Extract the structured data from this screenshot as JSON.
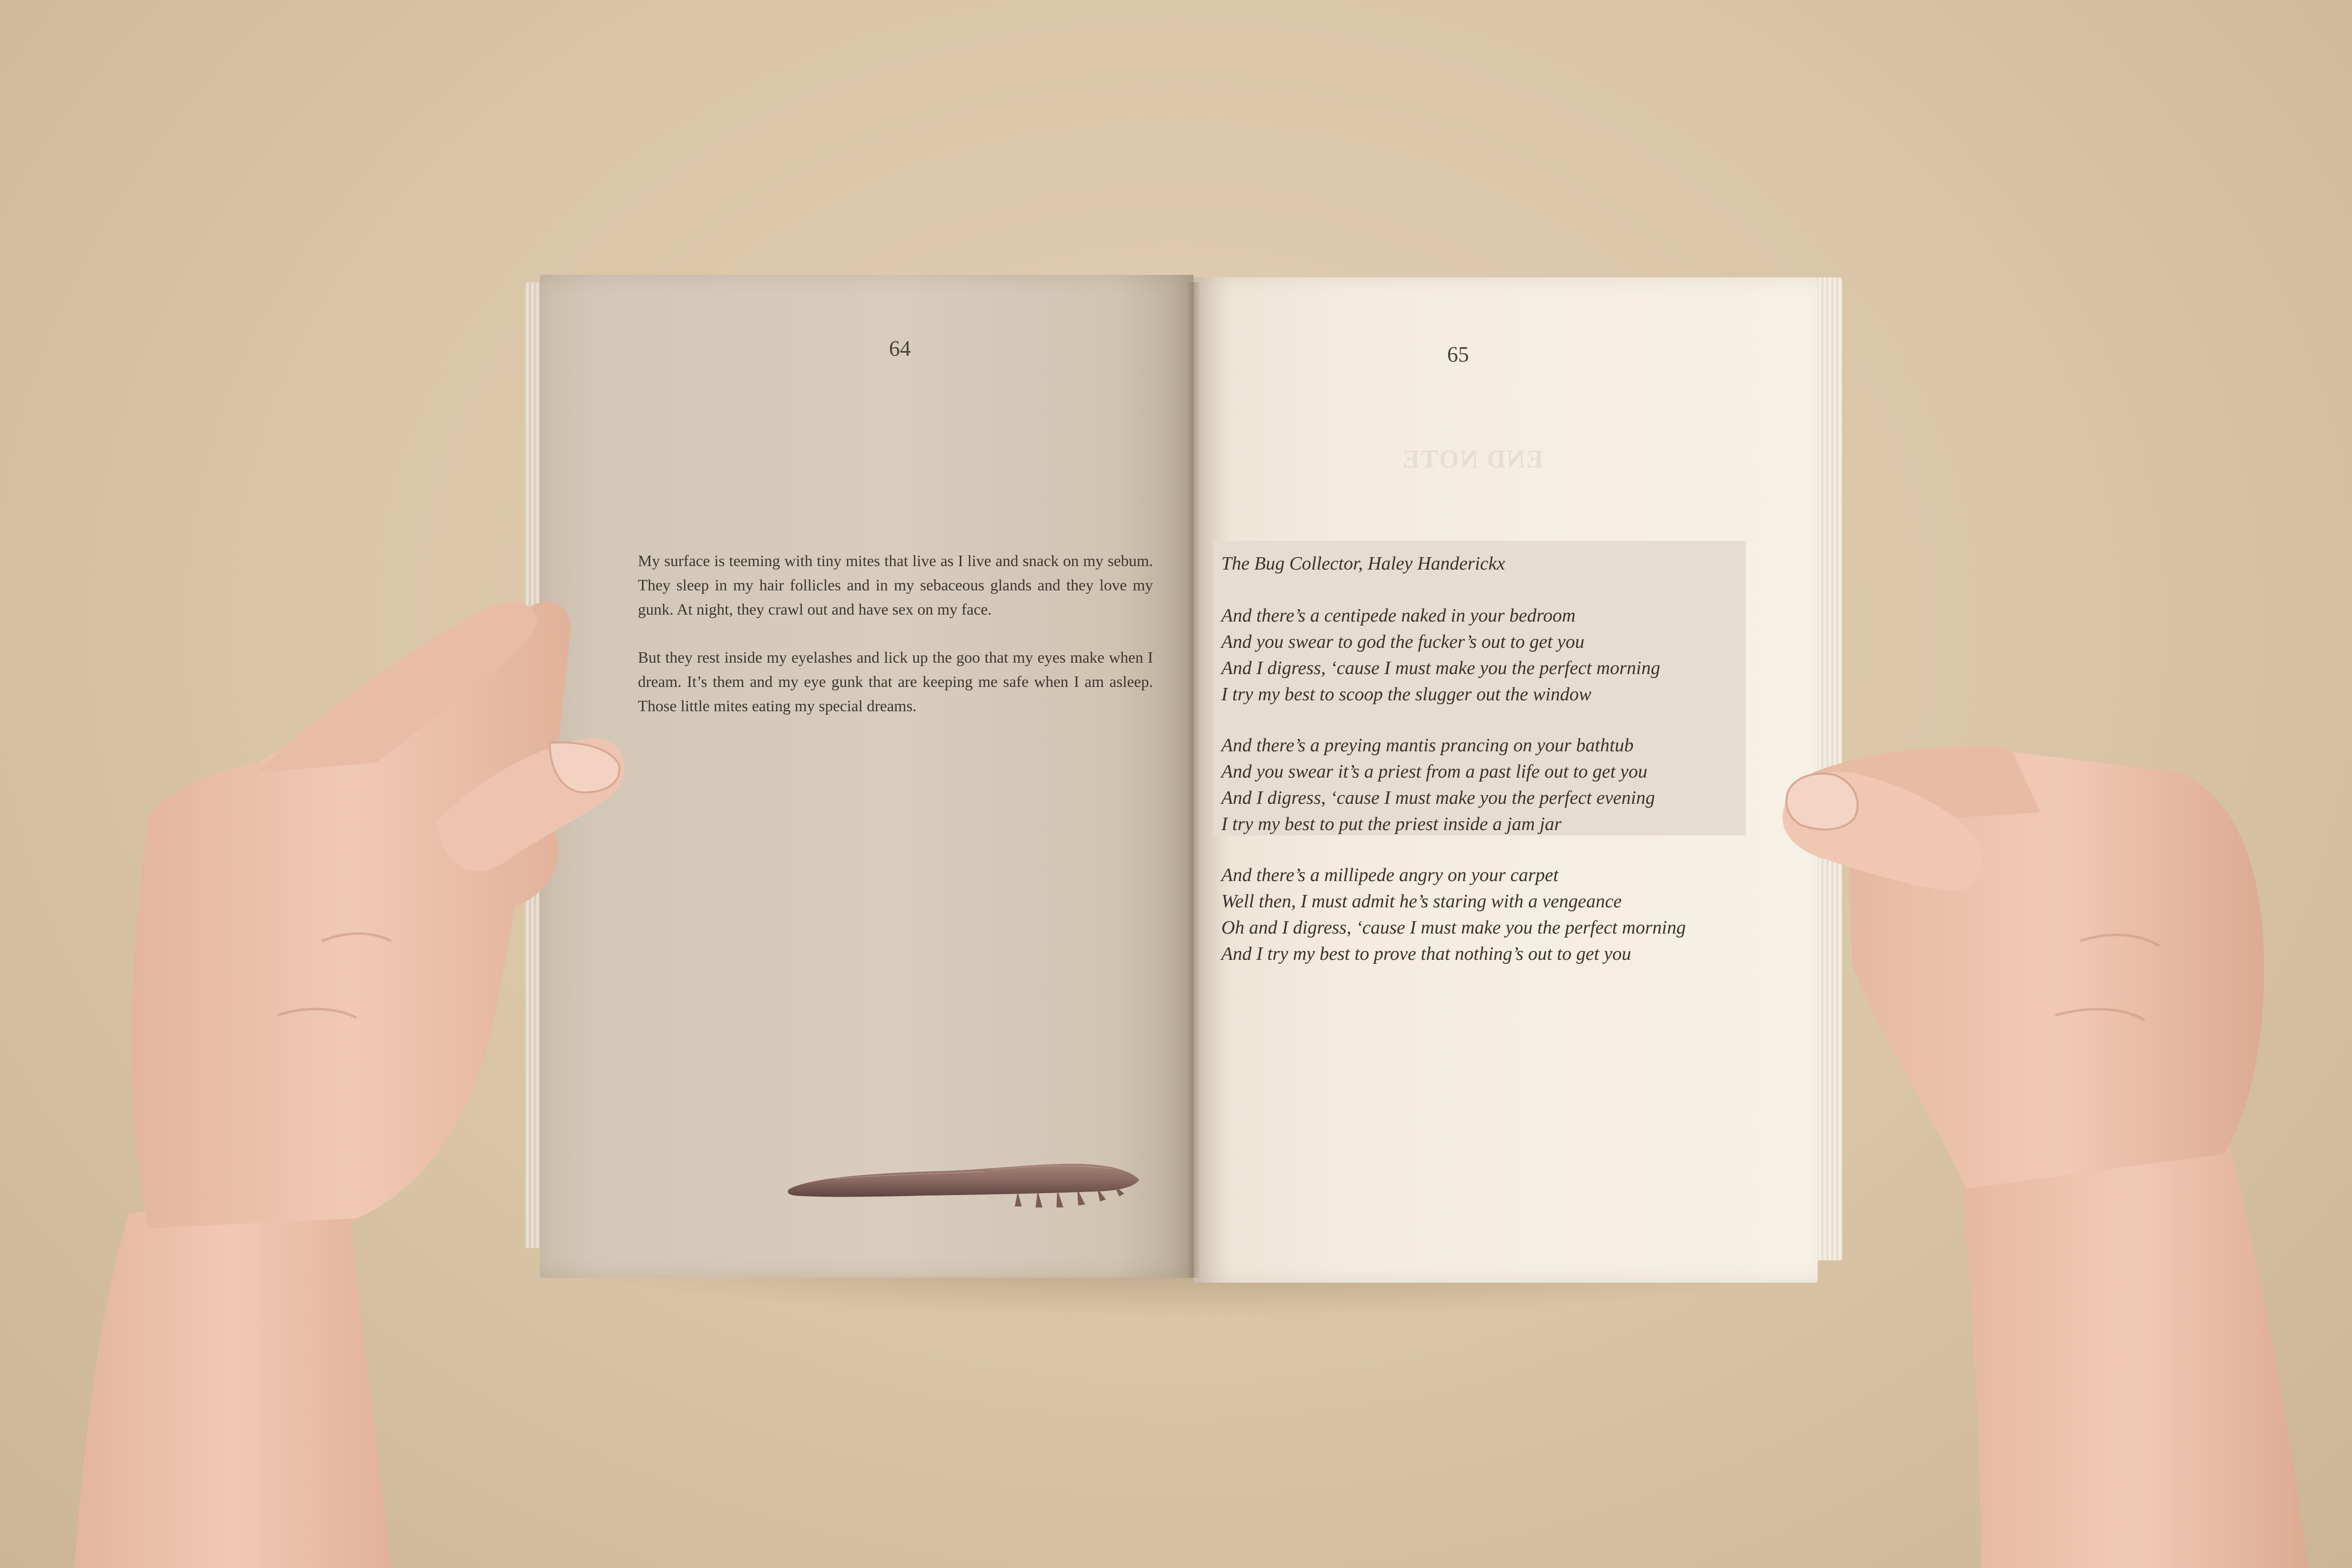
{
  "book": {
    "left_page": {
      "page_number": "64",
      "paragraphs": [
        "My surface is teeming with tiny mites that live as I live and snack on my sebum. They sleep in my hair follicles and in my sebaceous glands and they love my gunk. At night, they crawl out and have sex on my face.",
        "But they rest inside my eyelashes and lick up the goo that my eyes make when I dream. It’s them and my eye gunk that are keeping me safe when I am asleep. Those little mites eating my special dreams."
      ]
    },
    "right_page": {
      "page_number": "65",
      "show_through_heading": "END NOTE",
      "poem_title": "The Bug Collector, Haley Handerickx",
      "stanzas": [
        {
          "lines": [
            "And there’s a centipede naked in your bedroom",
            "And you swear to god the fucker’s out to get you",
            "And I digress, ‘cause I must make you the perfect morning",
            "I try my best to scoop the slugger out the window"
          ]
        },
        {
          "lines": [
            "And there’s a preying mantis prancing on your bathtub",
            "And you swear it’s a priest from a past life out to get you",
            "And I digress, ‘cause I must make you the perfect evening",
            "I try my best to put the priest inside a jam jar"
          ]
        },
        {
          "lines": [
            "And there’s a millipede angry on your carpet",
            "Well then, I must admit he’s staring with a vengeance",
            "Oh and I digress, ‘cause I must make you the perfect morning",
            "And I try my best to prove that nothing’s out to get you"
          ]
        }
      ]
    }
  },
  "colors": {
    "background": "#dcc8ab",
    "left_page": "#d8ccbd",
    "right_page": "#f4ece0",
    "poem_highlight": "#e6ddd1",
    "text": "#3d3530",
    "creature": "#8a6a60",
    "skin": "#e9c2ae"
  }
}
